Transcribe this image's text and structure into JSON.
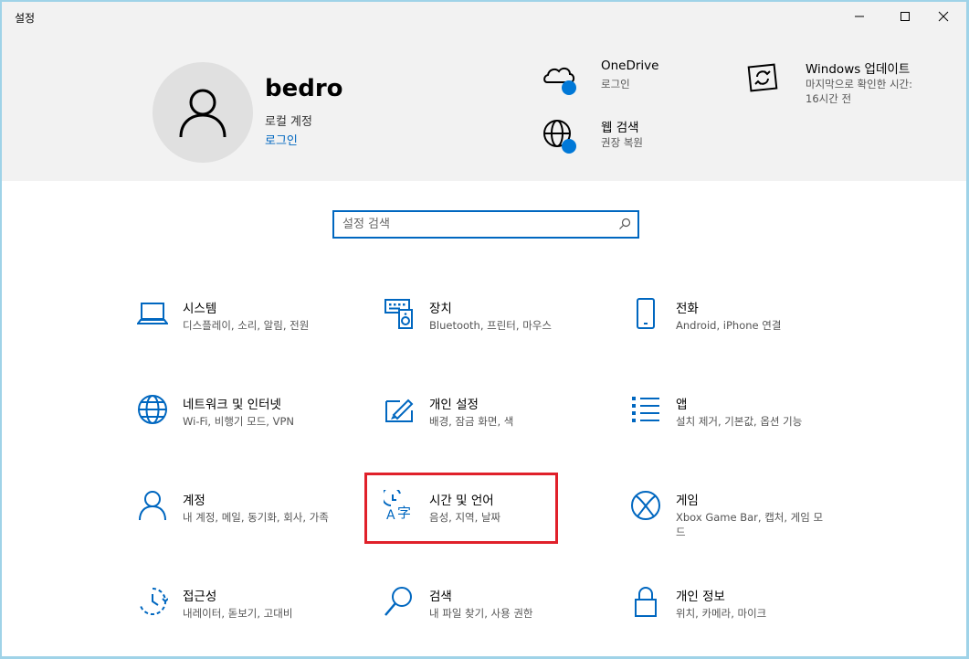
{
  "window": {
    "title": "설정"
  },
  "profile": {
    "name": "bedro",
    "account_type": "로컬 계정",
    "signin_link": "로그인"
  },
  "header_items": [
    {
      "title": "OneDrive",
      "subtitle": "로그인",
      "icon": "onedrive-cloud-icon"
    },
    {
      "title": "웹 검색",
      "subtitle": "권장 복원",
      "icon": "globe-icon"
    },
    {
      "title": "Windows 업데이트",
      "subtitle": "마지막으로 확인한 시간: 16시간 전",
      "icon": "windows-update-icon"
    }
  ],
  "search": {
    "placeholder": "설정 검색"
  },
  "categories": [
    {
      "title": "시스템",
      "subtitle": "디스플레이, 소리, 알림, 전원",
      "icon": "laptop-icon"
    },
    {
      "title": "장치",
      "subtitle": "Bluetooth, 프린터, 마우스",
      "icon": "keyboard-speaker-icon"
    },
    {
      "title": "전화",
      "subtitle": "Android, iPhone 연결",
      "icon": "phone-icon"
    },
    {
      "title": "네트워크 및 인터넷",
      "subtitle": "Wi-Fi, 비행기 모드, VPN",
      "icon": "globe-icon"
    },
    {
      "title": "개인 설정",
      "subtitle": "배경, 잠금 화면, 색",
      "icon": "paintbrush-icon"
    },
    {
      "title": "앱",
      "subtitle": "설치 제거, 기본값, 옵션 기능",
      "icon": "apps-list-icon"
    },
    {
      "title": "계정",
      "subtitle": "내 계정, 메일, 동기화, 회사, 가족",
      "icon": "person-icon"
    },
    {
      "title": "시간 및 언어",
      "subtitle": "음성, 지역, 날짜",
      "icon": "time-language-icon"
    },
    {
      "title": "게임",
      "subtitle": "Xbox Game Bar, 캡처, 게임 모드",
      "icon": "xbox-icon"
    },
    {
      "title": "접근성",
      "subtitle": "내레이터, 돋보기, 고대비",
      "icon": "ease-of-access-icon"
    },
    {
      "title": "검색",
      "subtitle": "내 파일 찾기, 사용 권한",
      "icon": "magnifier-icon"
    },
    {
      "title": "개인 정보",
      "subtitle": "위치, 카메라, 마이크",
      "icon": "lock-icon"
    }
  ],
  "colors": {
    "accent": "#0067c0",
    "highlight": "#e0202a",
    "header_bg": "#f2f2f2"
  }
}
